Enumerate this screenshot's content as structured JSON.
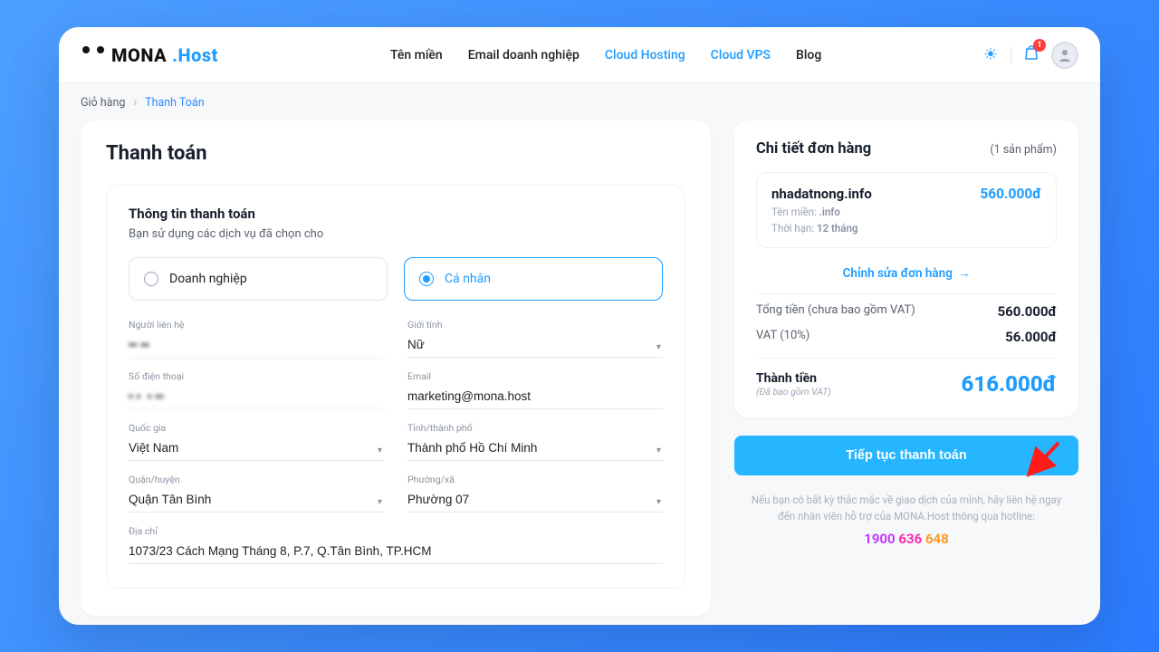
{
  "brand": {
    "part1": "MONA",
    "part2": ".Host"
  },
  "nav": {
    "items": [
      "Tên miền",
      "Email doanh nghiệp",
      "Cloud Hosting",
      "Cloud VPS",
      "Blog"
    ],
    "active_index": [
      2,
      3
    ]
  },
  "cart_badge": "1",
  "breadcrumb": {
    "root": "Giỏ hàng",
    "current": "Thanh Toán"
  },
  "page_title": "Thanh toán",
  "info": {
    "title": "Thông tin thanh toán",
    "subtitle": "Bạn sử dụng các dịch vụ đã chọn cho",
    "type_options": {
      "business": "Doanh nghiệp",
      "personal": "Cá nhân"
    },
    "selected_type": "personal",
    "fields": {
      "contact_label": "Người liên hệ",
      "contact_value": "•• ▪▪",
      "gender_label": "Giới tính",
      "gender_value": "Nữ",
      "phone_label": "Số điện thoại",
      "phone_value": "▪ ▪  ▪ ▪▪",
      "email_label": "Email",
      "email_value": "marketing@mona.host",
      "country_label": "Quốc gia",
      "country_value": "Việt Nam",
      "province_label": "Tỉnh/thành phố",
      "province_value": "Thành phố Hồ Chí Minh",
      "district_label": "Quận/huyện",
      "district_value": "Quận Tân Bình",
      "ward_label": "Phường/xã",
      "ward_value": "Phường 07",
      "address_label": "Địa chỉ",
      "address_value": "1073/23 Cách Mạng Tháng 8, P.7, Q.Tân Bình, TP.HCM"
    }
  },
  "summary": {
    "title": "Chi tiết đơn hàng",
    "count_label": "(1 sản phẩm)",
    "item": {
      "domain": "nhadatnong.info",
      "price": "560.000đ",
      "meta_tld_label": "Tên miền:",
      "meta_tld_value": ".info",
      "meta_term_label": "Thời hạn:",
      "meta_term_value": "12 tháng"
    },
    "edit_label": "Chỉnh sửa đơn hàng",
    "subtotal_label": "Tổng tiền (chưa bao gồm VAT)",
    "subtotal_value": "560.000đ",
    "vat_label": "VAT (10%)",
    "vat_value": "56.000đ",
    "total_label": "Thành tiền",
    "total_sub": "(Đã bao gồm VAT)",
    "total_value": "616.000đ",
    "cta": "Tiếp tục thanh toán",
    "helper": "Nếu bạn có bất kỳ thắc mắc về giao dịch của mình, hãy liên hệ ngay đến nhân viên hỗ trợ của MONA.Host thông qua hotline:",
    "hotline": {
      "p1": "1900",
      "p2": "636",
      "p3": "648"
    }
  }
}
